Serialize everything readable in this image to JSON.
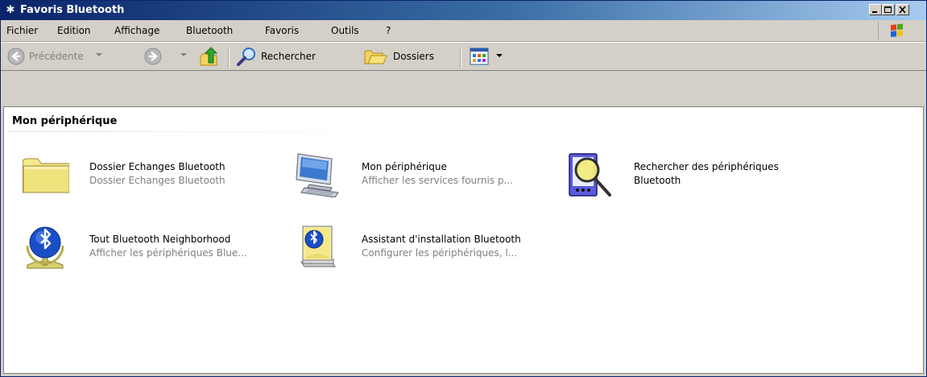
{
  "window": {
    "title": "Favoris Bluetooth"
  },
  "menu": {
    "items": [
      {
        "label": "Fichier"
      },
      {
        "label": "Edition"
      },
      {
        "label": "Affichage"
      },
      {
        "label": "Bluetooth"
      },
      {
        "label": "Favoris"
      },
      {
        "label": "Outils"
      },
      {
        "label": "?"
      }
    ]
  },
  "toolbar": {
    "back_label": "Précédente",
    "search_label": "Rechercher",
    "folders_label": "Dossiers"
  },
  "section": {
    "title": "Mon périphérique"
  },
  "items": [
    {
      "name": "Dossier Echanges Bluetooth",
      "desc": "Dossier Echanges Bluetooth"
    },
    {
      "name": "Mon périphérique",
      "desc": "Afficher les services fournis p..."
    },
    {
      "name": "Rechercher des périphériques",
      "desc": "Bluetooth"
    },
    {
      "name": "Tout Bluetooth Neighborhood",
      "desc": "Afficher les périphériques Blue..."
    },
    {
      "name": "Assistant d'installation Bluetooth",
      "desc": "Configurer les périphériques, l..."
    }
  ],
  "colors": {
    "titlebar": "#0a246a",
    "face": "#d4d0c8",
    "folder": "#f3e98c",
    "bluetooth": "#1a4ec8"
  }
}
